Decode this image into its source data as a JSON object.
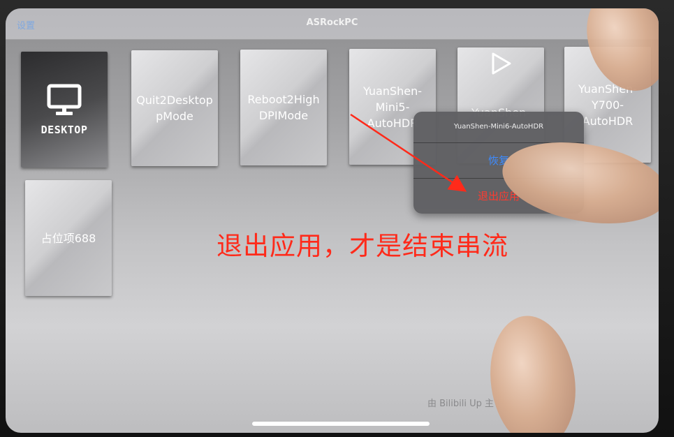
{
  "navbar": {
    "settings_label": "设置",
    "title": "ASRockPC"
  },
  "apps": [
    {
      "label": "DESKTOP",
      "icon": "monitor-icon"
    },
    {
      "label": "Quit2Desktop\npMode"
    },
    {
      "label": "Reboot2High\nDPIMode"
    },
    {
      "label": "YuanShen-\nMini5-\nAutoHDR"
    },
    {
      "label": "YuanShen-",
      "icon": "play-icon"
    },
    {
      "label": "YuanShen-\nY700-\nAutoHDR"
    },
    {
      "label": "占位项688"
    }
  ],
  "context_menu": {
    "title": "YuanShen-Mini6-AutoHDR",
    "resume_label": "恢复",
    "quit_label": "退出应用"
  },
  "annotation": {
    "text": "退出应用，才是结束串流",
    "color": "#ff2a1a"
  },
  "watermark": "由 Bilibili Up 主",
  "colors": {
    "accent_blue": "#3d8bff",
    "destructive_red": "#ff3b30"
  }
}
